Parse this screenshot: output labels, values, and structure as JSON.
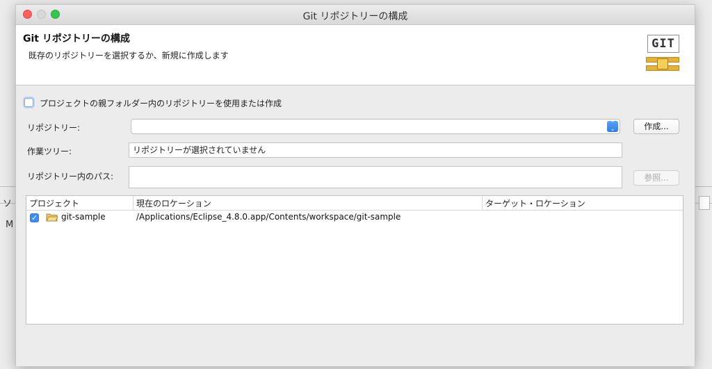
{
  "window": {
    "title": "Git リポジトリーの構成"
  },
  "header": {
    "title": "Git リポジトリーの構成",
    "description": "既存のリポジトリーを選択するか、新規に作成します",
    "logo_text": "GIT"
  },
  "form": {
    "use_parent_checkbox": {
      "label": "プロジェクトの親フォルダー内のリポジトリーを使用または作成",
      "checked": false
    },
    "repository": {
      "label": "リポジトリー:",
      "value": ""
    },
    "create_button": "作成...",
    "work_tree": {
      "label": "作業ツリー:",
      "value": "リポジトリーが選択されていません"
    },
    "path_in_repo": {
      "label": "リポジトリー内のパス:",
      "value": ""
    },
    "browse_button": "参照..."
  },
  "table": {
    "columns": [
      "プロジェクト",
      "現在のロケーション",
      "ターゲット・ロケーション"
    ],
    "rows": [
      {
        "checked": true,
        "project": "git-sample",
        "current_location": "/Applications/Eclipse_4.8.0.app/Contents/workspace/git-sample",
        "target_location": ""
      }
    ]
  },
  "background": {
    "left_text_1": "ソ",
    "left_text_2": "M"
  },
  "colors": {
    "accent": "#3b8ff2",
    "close": "#fc605c",
    "maximize": "#34c84a"
  }
}
